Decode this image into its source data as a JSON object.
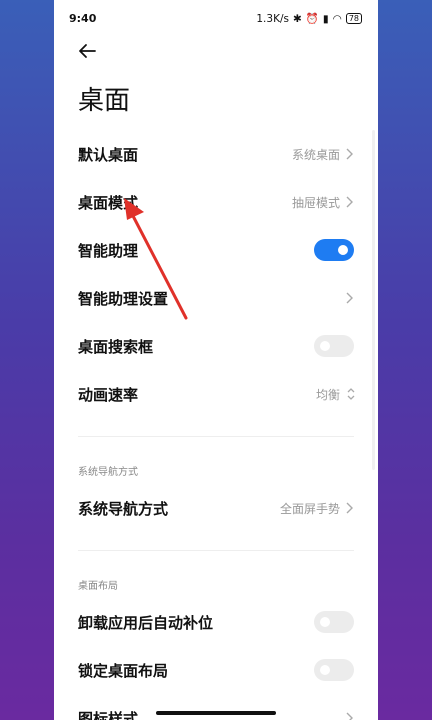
{
  "status": {
    "time": "9:40",
    "speed": "1.3K/s",
    "battery": "78"
  },
  "page": {
    "title": "桌面"
  },
  "rows": [
    {
      "label": "默认桌面",
      "value": "系统桌面"
    },
    {
      "label": "桌面模式",
      "value": "抽屉模式"
    },
    {
      "label": "智能助理",
      "toggle": true
    },
    {
      "label": "智能助理设置"
    },
    {
      "label": "桌面搜索框",
      "toggle": false
    },
    {
      "label": "动画速率",
      "value": "均衡"
    }
  ],
  "sections": [
    {
      "title": "系统导航方式",
      "rows": [
        {
          "label": "系统导航方式",
          "value": "全面屏手势"
        }
      ]
    },
    {
      "title": "桌面布局",
      "rows": [
        {
          "label": "卸载应用后自动补位",
          "toggle": false
        },
        {
          "label": "锁定桌面布局",
          "toggle": false
        },
        {
          "label": "图标样式"
        }
      ]
    }
  ],
  "colors": {
    "accent": "#1e7cf2",
    "annotation_arrow": "#e0312a"
  }
}
